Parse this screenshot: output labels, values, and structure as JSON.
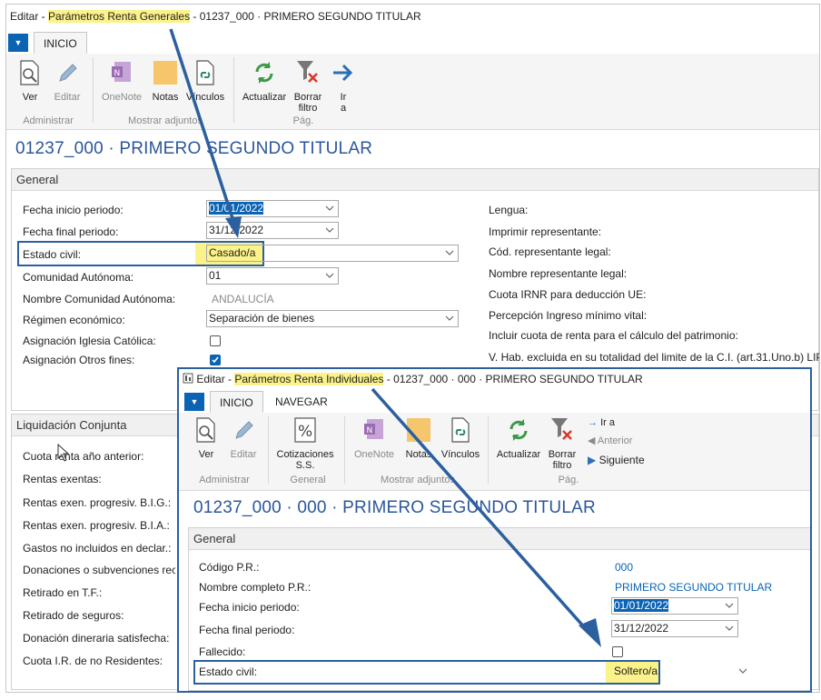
{
  "win1": {
    "title_prefix": "Editar - ",
    "title_highlight": "Parámetros Renta Generales",
    "title_suffix": " - 01237_000 · PRIMERO SEGUNDO TITULAR",
    "tab_inicio": "INICIO",
    "buttons": {
      "ver": "Ver",
      "editar": "Editar",
      "onenote": "OneNote",
      "notas": "Notas",
      "vinculos": "Vínculos",
      "actualizar": "Actualizar",
      "borrar_l1": "Borrar",
      "borrar_l2": "filtro",
      "ira_l1": "Ir",
      "ira_l2": "a"
    },
    "groups": {
      "administrar": "Administrar",
      "mostrar": "Mostrar adjuntos",
      "pag": "Pág."
    },
    "record_title": "01237_000 · PRIMERO SEGUNDO TITULAR",
    "general_header": "General",
    "fields": {
      "fecha_inicio_label": "Fecha inicio periodo:",
      "fecha_inicio_value": "01/01/2022",
      "fecha_final_label": "Fecha final periodo:",
      "fecha_final_value": "31/12/2022",
      "estado_civil_label": "Estado civil:",
      "estado_civil_value": "Casado/a",
      "comunidad_label": "Comunidad Autónoma:",
      "comunidad_value": "01",
      "nombre_comunidad_label": "Nombre Comunidad Autónoma:",
      "nombre_comunidad_value": "ANDALUCÍA",
      "regimen_label": "Régimen económico:",
      "regimen_value": "Separación de bienes",
      "iglesia_label": "Asignación Iglesia Católica:",
      "otros_label": "Asignación Otros fines:"
    },
    "right_fields": {
      "lengua": "Lengua:",
      "imprimir": "Imprimir representante:",
      "cod_rep": "Cód. representante legal:",
      "nombre_rep": "Nombre representante legal:",
      "cuota_irnr": "Cuota IRNR para deducción UE:",
      "percepcion": "Percepción Ingreso mínimo vital:",
      "incluir": "Incluir cuota de renta para el cálculo del patrimonio:",
      "vhab": "V. Hab. excluida en su totalidad del limite de la C.I. (art.31.Uno.b) LIP):"
    },
    "liquidacion_header": "Liquidación Conjunta",
    "liquidacion": {
      "cuota": "Cuota renta año anterior:",
      "exentas": "Rentas exentas:",
      "big": "Rentas exen. progresiv. B.I.G.:",
      "bia": "Rentas exen. progresiv. B.I.A.:",
      "gastos": "Gastos no incluidos en declar.:",
      "donaciones": "Donaciones o subvenciones recibid",
      "retirado_tf": "Retirado en T.F.:",
      "retirado_seg": "Retirado de seguros:",
      "donacion_din": "Donación dineraria satisfecha:",
      "cuota_ir": "Cuota I.R. de no Residentes:"
    }
  },
  "win2": {
    "title_prefix": "Editar - ",
    "title_highlight": "Parámetros Renta Individuales",
    "title_suffix": " - 01237_000 · 000 · PRIMERO SEGUNDO TITULAR",
    "tab_inicio": "INICIO",
    "tab_navegar": "NAVEGAR",
    "buttons": {
      "ver": "Ver",
      "editar": "Editar",
      "cot_l1": "Cotizaciones",
      "cot_l2": "S.S.",
      "onenote": "OneNote",
      "notas": "Notas",
      "vinculos": "Vínculos",
      "actualizar": "Actualizar",
      "borrar_l1": "Borrar",
      "borrar_l2": "filtro",
      "ira": "Ir a",
      "anterior": "Anterior",
      "siguiente": "Siguiente"
    },
    "groups": {
      "administrar": "Administrar",
      "general": "General",
      "mostrar": "Mostrar adjuntos",
      "pag": "Pág."
    },
    "record_title": "01237_000 · 000 · PRIMERO SEGUNDO TITULAR",
    "general_header": "General",
    "fields": {
      "codigo_label": "Código P.R.:",
      "codigo_value": "000",
      "nombre_label": "Nombre completo P.R.:",
      "nombre_value": "PRIMERO SEGUNDO TITULAR",
      "fecha_inicio_label": "Fecha inicio periodo:",
      "fecha_inicio_value": "01/01/2022",
      "fecha_final_label": "Fecha final periodo:",
      "fecha_final_value": "31/12/2022",
      "fallecido_label": "Fallecido:",
      "estado_civil_label": "Estado civil:",
      "estado_civil_value": "Soltero/a"
    }
  },
  "colors": {
    "accent": "#0b63b3",
    "highlight": "#fbf28a",
    "arrow": "#2b5f9e"
  }
}
